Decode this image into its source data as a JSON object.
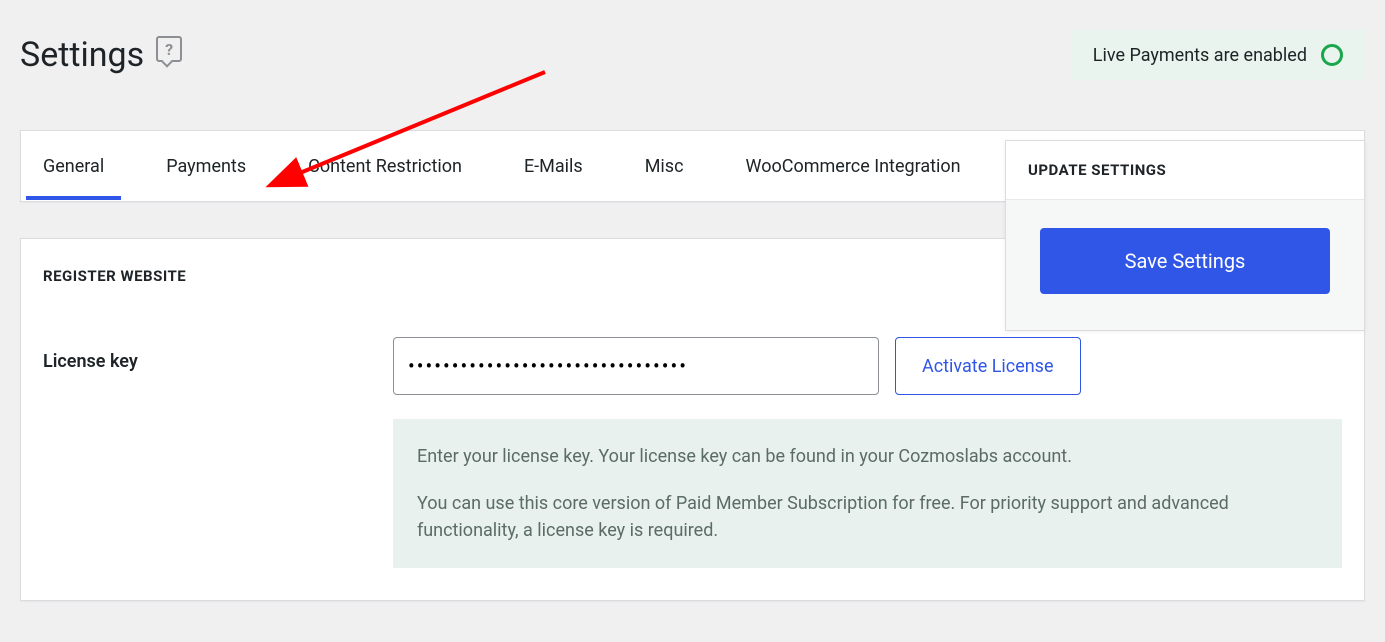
{
  "header": {
    "title": "Settings",
    "status_text": "Live Payments are enabled"
  },
  "tabs": {
    "items": [
      {
        "label": "General"
      },
      {
        "label": "Payments"
      },
      {
        "label": "Content Restriction"
      },
      {
        "label": "E-Mails"
      },
      {
        "label": "Misc"
      },
      {
        "label": "WooCommerce Integration"
      }
    ]
  },
  "register": {
    "section_title": "REGISTER WEBSITE",
    "label": "License key",
    "license_value": "••••••••••••••••••••••••••••••••",
    "activate_label": "Activate License",
    "help_line1": "Enter your license key. Your license key can be found in your Cozmoslabs account.",
    "help_line2": "You can use this core version of Paid Member Subscription for free. For priority support and advanced functionality, a license key is required."
  },
  "side": {
    "title": "UPDATE SETTINGS",
    "save_label": "Save Settings"
  }
}
